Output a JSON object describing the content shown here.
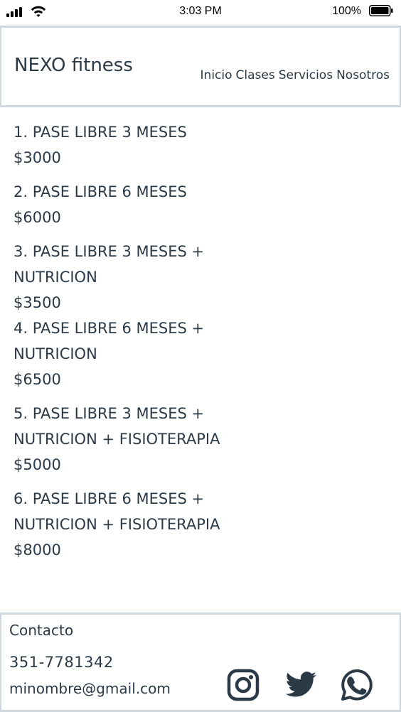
{
  "status_bar": {
    "time": "3:03 PM",
    "battery": "100%"
  },
  "header": {
    "brand": "NEXO fitness",
    "nav": [
      "Inicio",
      "Clases",
      "Servicios",
      "Nosotros"
    ]
  },
  "plans": [
    {
      "lines": [
        "1. PASE LIBRE 3 MESES"
      ],
      "price": "$3000"
    },
    {
      "lines": [
        "2. PASE LIBRE 6 MESES"
      ],
      "price": "$6000"
    },
    {
      "lines": [
        "3. PASE LIBRE 3 MESES +",
        "NUTRICION"
      ],
      "price": "$3500"
    },
    {
      "lines": [
        "4. PASE LIBRE 6 MESES +",
        "NUTRICION"
      ],
      "price": "$6500"
    },
    {
      "lines": [
        "5. PASE LIBRE 3 MESES +",
        "NUTRICION + FISIOTERAPIA"
      ],
      "price": "$5000"
    },
    {
      "lines": [
        "6. PASE LIBRE 6 MESES +",
        "NUTRICION + FISIOTERAPIA"
      ],
      "price": "$8000"
    }
  ],
  "footer": {
    "title": "Contacto",
    "phone": "351-7781342",
    "email": "minombre@gmail.com",
    "social": [
      "instagram-icon",
      "twitter-icon",
      "whatsapp-icon"
    ]
  },
  "colors": {
    "text": "#2c3a47",
    "border": "#cfd8e1",
    "background": "#ffffff"
  }
}
